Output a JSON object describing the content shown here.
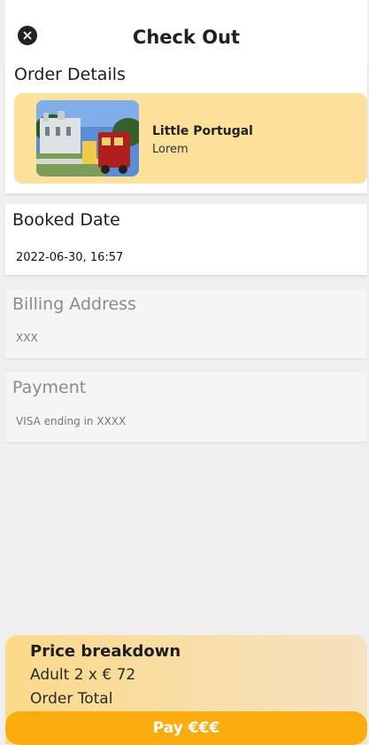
{
  "header": {
    "title": "Check Out",
    "close_icon": "close-icon"
  },
  "order_details": {
    "section_title": "Order Details",
    "product": {
      "name": "Little Portugal",
      "subtitle": "Lorem",
      "image": "landscape-thumbnail"
    }
  },
  "booked_date": {
    "section_title": "Booked Date",
    "value": "2022-06-30, 16:57"
  },
  "billing_address": {
    "section_title": "Billing Address",
    "value": "XXX"
  },
  "payment": {
    "section_title": "Payment",
    "value": "VISA ending in XXXX"
  },
  "price_breakdown": {
    "title": "Price breakdown",
    "rows": [
      "Adult 2 x € 72",
      "Order Total"
    ]
  },
  "pay_button": {
    "label": "Pay €€€"
  },
  "colors": {
    "accent": "#fbad10",
    "card_background": "#fde09a"
  }
}
